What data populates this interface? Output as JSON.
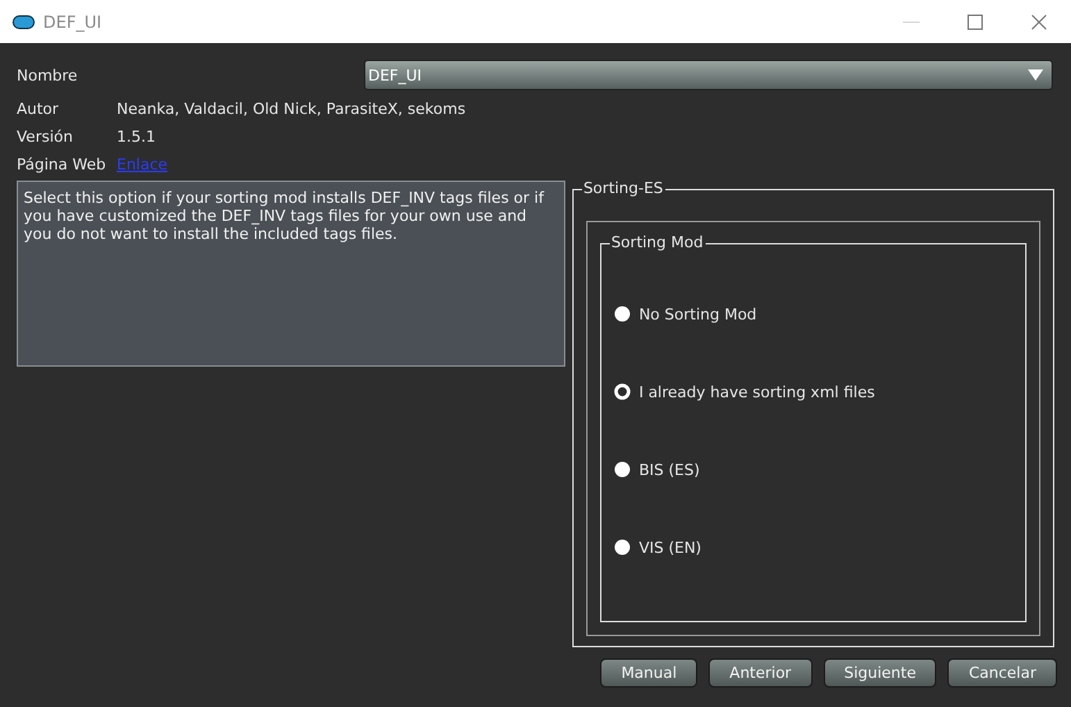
{
  "window": {
    "title": "DEF_UI"
  },
  "name_field": {
    "label": "Nombre",
    "value": "DEF_UI"
  },
  "info": [
    {
      "label": "Autor",
      "value": "Neanka, Valdacil, Old Nick, ParasiteX, sekoms",
      "kind": "text"
    },
    {
      "label": "Versión",
      "value": "1.5.1",
      "kind": "text"
    },
    {
      "label": "Página Web",
      "value": "Enlace",
      "kind": "link"
    }
  ],
  "description": "Select this option if your sorting mod installs DEF_INV tags files or if you have customized the DEF_INV tags files for your own use and you do not want to install the included tags files.",
  "group": {
    "title": "Sorting-ES",
    "inner_title": "Sorting Mod",
    "options": [
      {
        "label": "No Sorting Mod",
        "selected": false
      },
      {
        "label": "I already have sorting xml files",
        "selected": true
      },
      {
        "label": "BIS (ES)",
        "selected": false
      },
      {
        "label": "VIS (EN)",
        "selected": false
      }
    ]
  },
  "buttons": [
    "Manual",
    "Anterior",
    "Siguiente",
    "Cancelar"
  ]
}
